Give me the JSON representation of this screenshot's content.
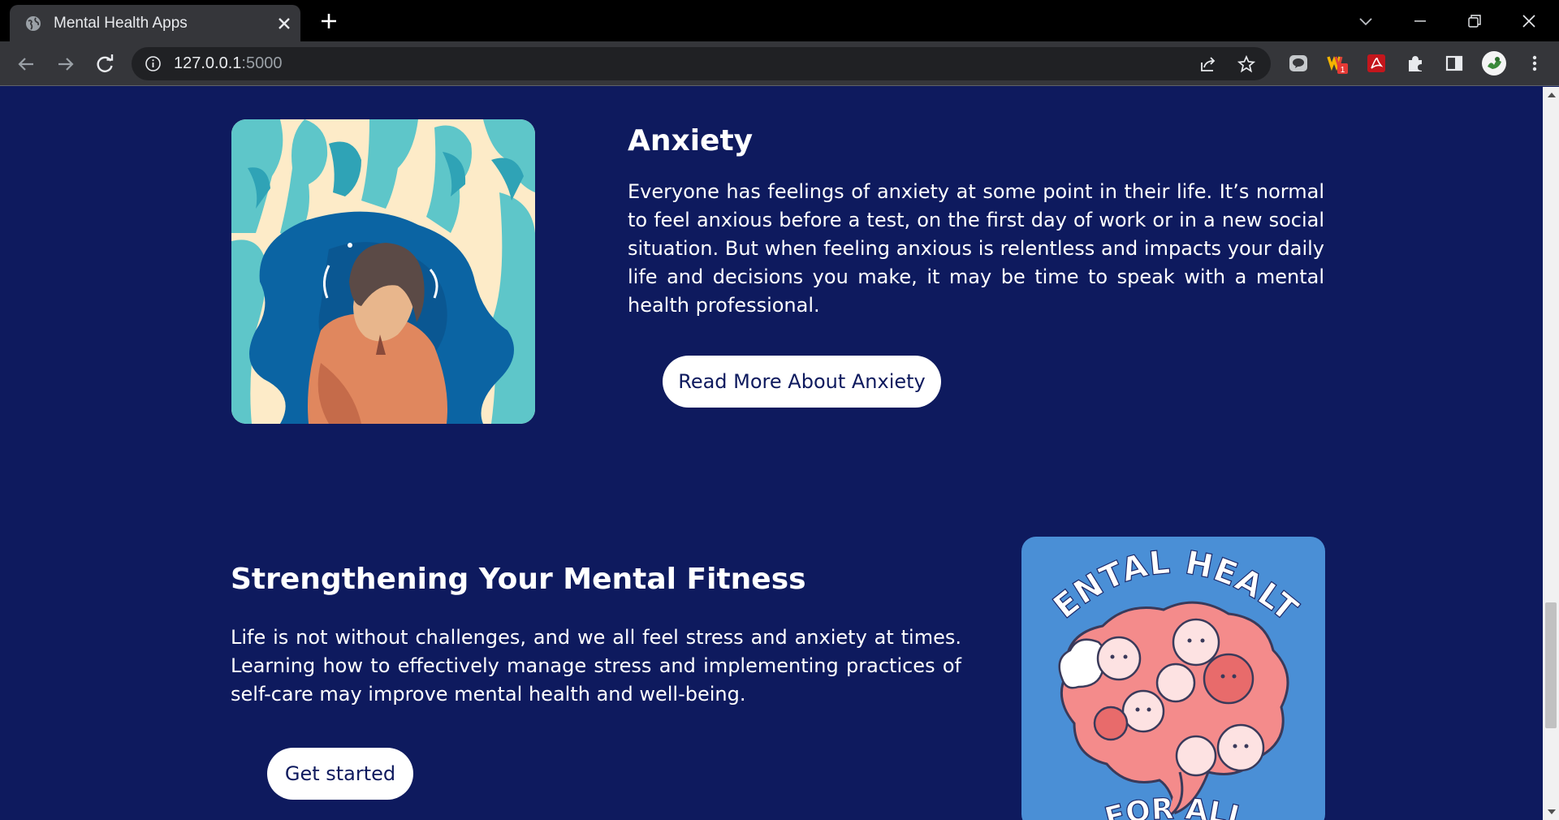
{
  "browser": {
    "tab_title": "Mental Health Apps",
    "url_host": "127.0.0.1",
    "url_port": ":5000",
    "extension_badge": "1"
  },
  "anxiety": {
    "heading": "Anxiety",
    "body": "Everyone has feelings of anxiety at some point in their life. It’s normal to feel anxious before a test, on the first day of work or in a new social situation. But when feeling anxious is relentless and impacts your daily life and decisions you make, it may be time to speak with a mental health professional.",
    "button_label": "Read More About Anxiety"
  },
  "fitness": {
    "heading": "Strengthening Your Mental Fitness",
    "body": "Life is not without challenges, and we all feel stress and anxiety at times. Learning how to effectively manage stress and implementing practices of self-care may improve mental health and well-being.",
    "button_label": "Get started"
  },
  "poster": {
    "top_text": "MENTAL HEALTH",
    "bottom_text": "FOR ALL"
  },
  "colors": {
    "page_background": "#0e1a5e",
    "button_background": "#ffffff",
    "button_text": "#0e1a5e",
    "poster_background": "#4a8fd6",
    "illustration_background": "#fdebc8"
  }
}
